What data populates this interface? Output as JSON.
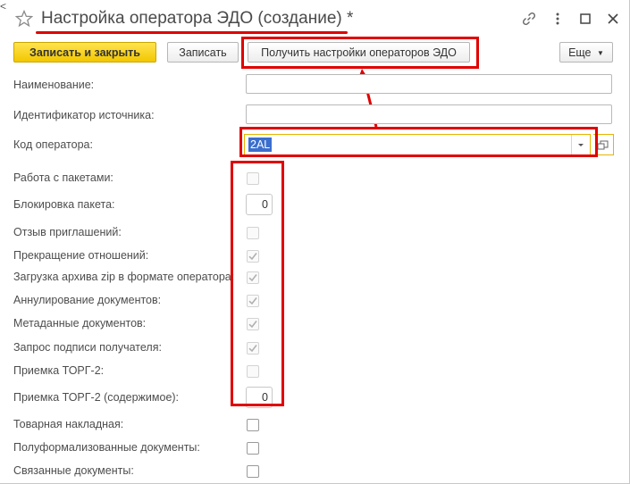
{
  "window": {
    "title": "Настройка оператора ЭДО (создание) *"
  },
  "toolbar": {
    "save_close_label": "Записать и закрыть",
    "save_label": "Записать",
    "get_settings_label": "Получить настройки операторов ЭДО",
    "more_label": "Еще"
  },
  "fields": {
    "name_label": "Наименование:",
    "name_value": "",
    "source_id_label": "Идентификатор источника:",
    "source_id_value": "",
    "operator_code_label": "Код оператора:",
    "operator_code_value": "2AL"
  },
  "options": [
    {
      "label": "Работа с пакетами:",
      "type": "checkbox",
      "checked": false,
      "enabled": false
    },
    {
      "label": "Блокировка пакета:",
      "type": "number",
      "value": "0"
    },
    {
      "label": "Отзыв приглашений:",
      "type": "checkbox",
      "checked": false,
      "enabled": false
    },
    {
      "label": "Прекращение отношений:",
      "type": "checkbox",
      "checked": true,
      "enabled": false
    },
    {
      "label": "Загрузка архива zip в формате оператора:",
      "type": "checkbox",
      "checked": true,
      "enabled": false
    },
    {
      "label": "Аннулирование документов:",
      "type": "checkbox",
      "checked": true,
      "enabled": false
    },
    {
      "label": "Метаданные документов:",
      "type": "checkbox",
      "checked": true,
      "enabled": false
    },
    {
      "label": "Запрос подписи получателя:",
      "type": "checkbox",
      "checked": true,
      "enabled": false
    },
    {
      "label": "Приемка ТОРГ-2:",
      "type": "checkbox",
      "checked": false,
      "enabled": false
    },
    {
      "label": "Приемка ТОРГ-2 (содержимое):",
      "type": "number",
      "value": "0"
    },
    {
      "label": "Товарная накладная:",
      "type": "checkbox",
      "checked": false,
      "enabled": true
    },
    {
      "label": "Полуформализованные документы:",
      "type": "checkbox",
      "checked": false,
      "enabled": true
    },
    {
      "label": "Связанные документы:",
      "type": "checkbox",
      "checked": false,
      "enabled": true
    }
  ],
  "colors": {
    "annotation_red": "#e00000",
    "primary_button": "#f2c700",
    "selection": "#3b6fce"
  }
}
